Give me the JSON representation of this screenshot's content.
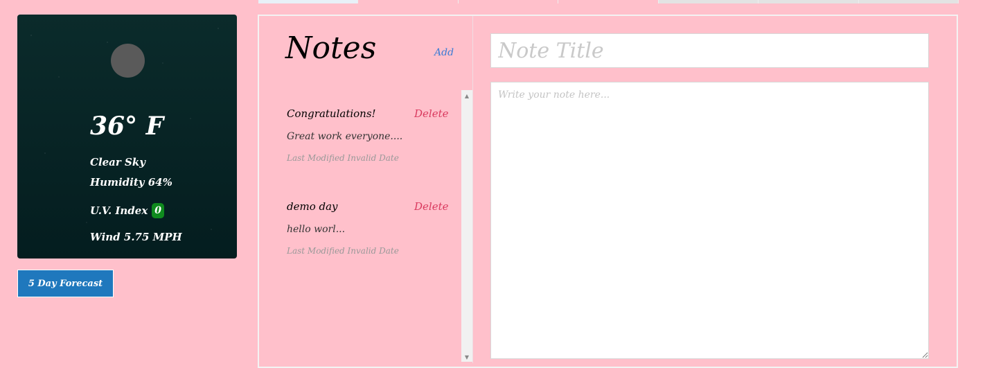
{
  "weather": {
    "temperature": "36° F",
    "condition": "Clear Sky",
    "humidity": "Humidity 64%",
    "uv_label": "U.V. Index",
    "uv_value": "0",
    "wind": "Wind 5.75 MPH"
  },
  "forecast_button": "5 Day Forecast",
  "tabs": [
    {},
    {},
    {},
    {},
    {},
    {},
    {}
  ],
  "notes": {
    "heading": "Notes",
    "add_label": "Add",
    "items": [
      {
        "title": "Congratulations!",
        "delete_label": "Delete",
        "preview": "Great work everyone....",
        "modified": "Last Modified Invalid Date"
      },
      {
        "title": "demo day",
        "delete_label": "Delete",
        "preview": "hello worl...",
        "modified": "Last Modified Invalid Date"
      }
    ]
  },
  "editor": {
    "title_placeholder": "Note Title",
    "body_placeholder": "Write your note here..."
  },
  "colors": {
    "page_background": "#ffc0cb",
    "forecast_button": "#1f78bd",
    "uv_badge": "#0f8a1e",
    "delete_link": "#d9395e",
    "add_link": "#3a7bd5"
  }
}
